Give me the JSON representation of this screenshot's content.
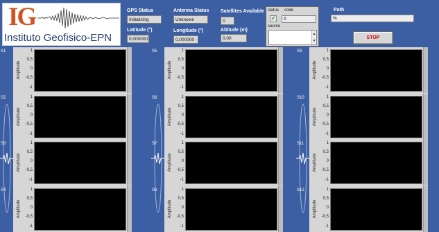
{
  "logo": {
    "letters": "IG",
    "text": "Instituto Geofisico-EPN"
  },
  "gps": {
    "gps_status_label": "GPS Status",
    "gps_status_value": "Initializing",
    "antenna_status_label": "Antenna Status",
    "antenna_status_value": "Unknown",
    "satellites_label": "Satellites Available",
    "satellites_value": "0",
    "latitude_label": "Latitude (°)",
    "latitude_value": "0,000000",
    "longitude_label": "Longitude (°)",
    "longitude_value": "0,000000",
    "altitude_label": "Altitude (m)",
    "altitude_value": "0,00"
  },
  "status_panel": {
    "status_label": "status",
    "status_mark": "✓",
    "code_label": "code",
    "code_value": "0",
    "source_label": "source"
  },
  "path": {
    "label": "Path",
    "value": "%"
  },
  "stop_button": {
    "label": "STOP"
  },
  "axis": {
    "ylabel": "Amplitude",
    "ticks": [
      "1",
      "0,5",
      "0",
      "-0,5",
      "-1"
    ]
  },
  "channels": [
    "S1",
    "S2",
    "S3",
    "S4",
    "S5",
    "S6",
    "S7",
    "S8",
    "S9",
    "S10",
    "S11",
    "S12"
  ],
  "colors": {
    "background": "#3c5fa3",
    "panel": "#d6d6d6",
    "plot": "#000000",
    "stop": "#d40000",
    "logo_orange": "#d0531f"
  }
}
